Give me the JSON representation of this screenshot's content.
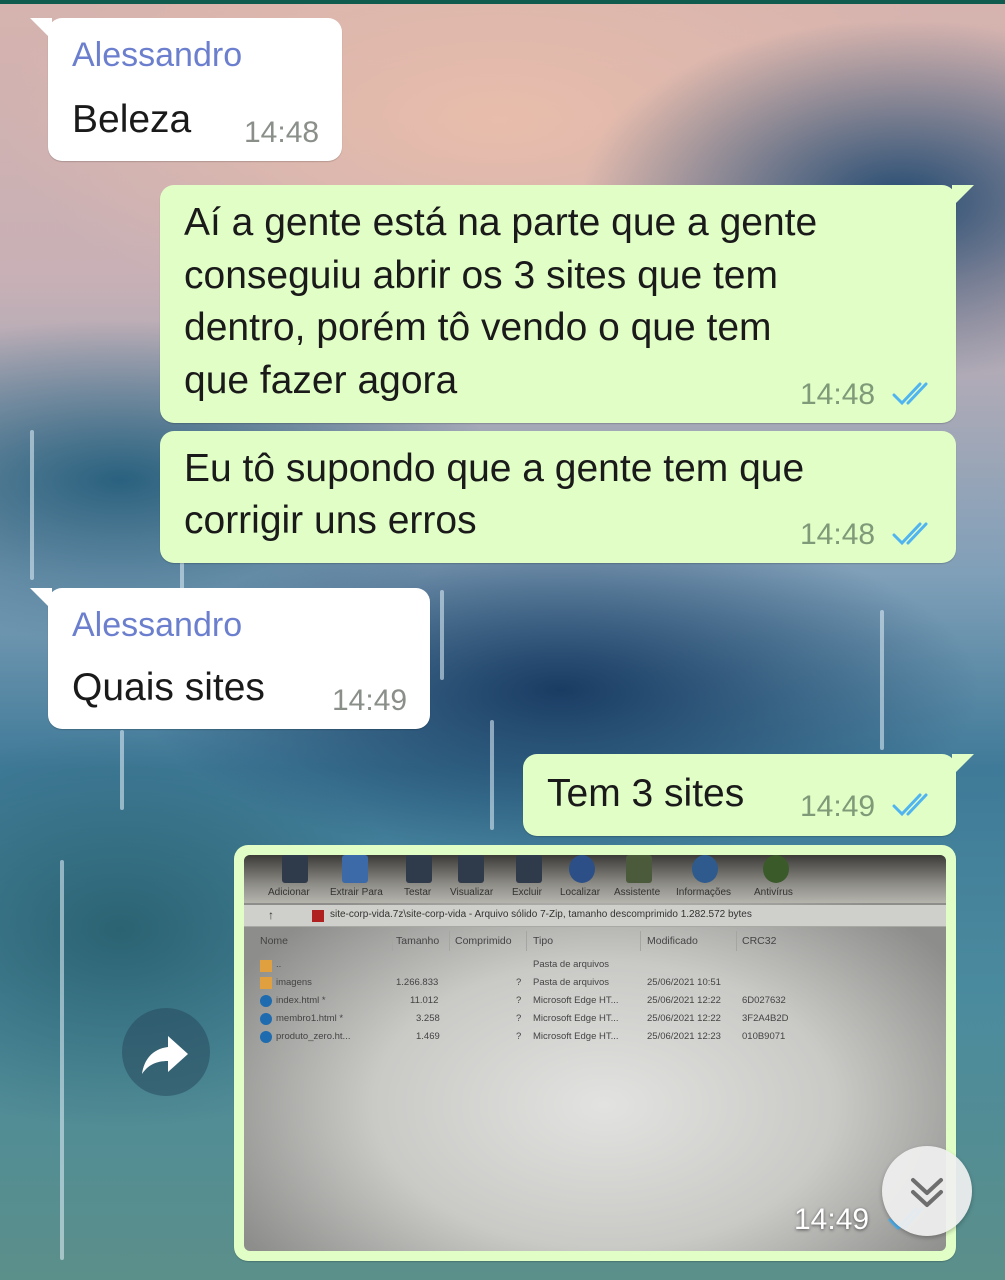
{
  "messages": [
    {
      "sender": "Alessandro",
      "text": "Beleza",
      "time": "14:48"
    },
    {
      "text_lines": [
        "Aí a gente está na parte que a gente",
        "conseguiu abrir os 3 sites que tem",
        "dentro, porém tô vendo o que tem",
        "que fazer agora"
      ],
      "time": "14:48"
    },
    {
      "text_lines": [
        "Eu tô supondo que a gente tem que",
        "corrigir uns erros"
      ],
      "time": "14:48"
    },
    {
      "sender": "Alessandro",
      "text": "Quais sites",
      "time": "14:49"
    },
    {
      "text": "Tem 3 sites",
      "time": "14:49"
    },
    {
      "time": "14:49"
    }
  ],
  "photo": {
    "toolbar": [
      "Adicionar",
      "Extrair Para",
      "Testar",
      "Visualizar",
      "Excluir",
      "Localizar",
      "Assistente",
      "Informações",
      "Antivírus"
    ],
    "path": "site-corp-vida.7z\\site-corp-vida - Arquivo sólido 7-Zip, tamanho descomprimido 1.282.572 bytes",
    "columns": [
      "Nome",
      "Tamanho",
      "Comprimido",
      "Tipo",
      "Modificado",
      "CRC32"
    ],
    "rows": [
      {
        "name": "..",
        "size": "",
        "packed": "",
        "type": "Pasta de arquivos",
        "modified": "",
        "crc": ""
      },
      {
        "name": "imagens",
        "size": "1.266.833",
        "packed": "?",
        "type": "Pasta de arquivos",
        "modified": "25/06/2021 10:51",
        "crc": ""
      },
      {
        "name": "index.html *",
        "size": "11.012",
        "packed": "?",
        "type": "Microsoft Edge HT...",
        "modified": "25/06/2021 12:22",
        "crc": "6D027632"
      },
      {
        "name": "membro1.html *",
        "size": "3.258",
        "packed": "?",
        "type": "Microsoft Edge HT...",
        "modified": "25/06/2021 12:22",
        "crc": "3F2A4B2D"
      },
      {
        "name": "produto_zero.ht...",
        "size": "1.469",
        "packed": "?",
        "type": "Microsoft Edge HT...",
        "modified": "25/06/2021 12:23",
        "crc": "010B9071"
      }
    ]
  },
  "colors": {
    "incoming": "#ffffff",
    "outgoing": "#e1fec6",
    "sender": "#6b7fce",
    "read_ticks": "#4fb4f0"
  },
  "icons": {
    "share": "share-arrow-icon",
    "scroll": "double-chevron-down-icon",
    "read": "double-check-icon"
  }
}
